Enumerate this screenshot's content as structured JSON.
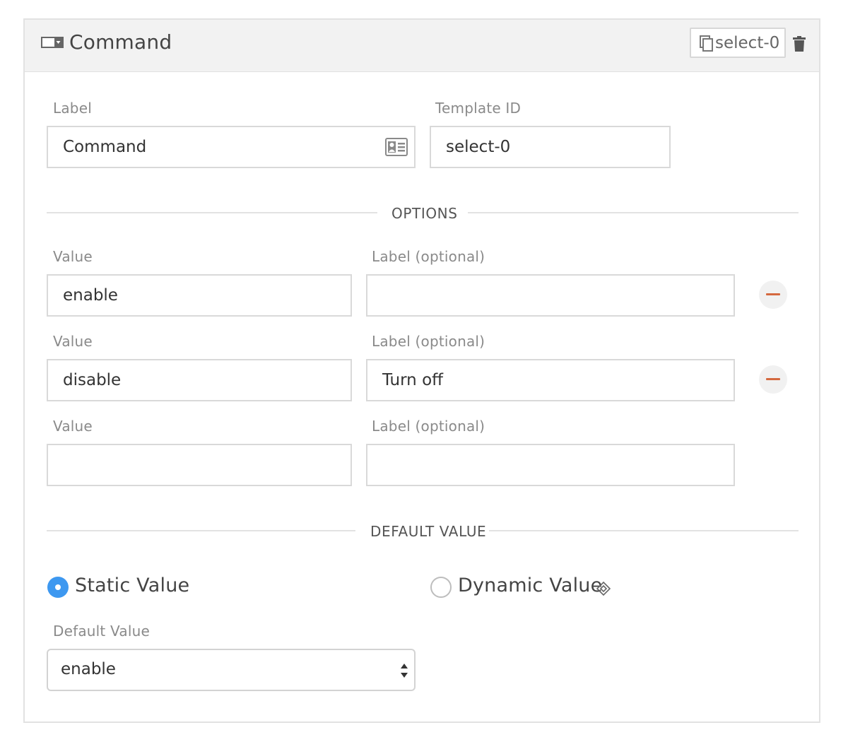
{
  "header": {
    "title": "Command",
    "field_icon": "select-field-icon",
    "id_badge": "select-0",
    "copy_icon": "copy-icon",
    "delete_icon": "trash-icon"
  },
  "fields": {
    "label": {
      "label": "Label",
      "value": "Command",
      "icon": "contact-card-icon"
    },
    "template_id": {
      "label": "Template ID",
      "value": "select-0"
    }
  },
  "options_section": {
    "title": "OPTIONS",
    "rows": [
      {
        "value_label": "Value",
        "value": "enable",
        "label_label": "Label (optional)",
        "label_value": ""
      },
      {
        "value_label": "Value",
        "value": "disable",
        "label_label": "Label (optional)",
        "label_value": "Turn off"
      },
      {
        "value_label": "Value",
        "value": "",
        "label_label": "Label (optional)",
        "label_value": ""
      }
    ],
    "remove_icon": "minus-icon"
  },
  "default_section": {
    "title": "DEFAULT VALUE",
    "static_label": "Static Value",
    "static_selected": true,
    "dynamic_label": "Dynamic Value",
    "dynamic_icon": "diamond-icon",
    "default_value_label": "Default Value",
    "default_value": "enable"
  },
  "colors": {
    "accent": "#3d98f0",
    "remove": "#d4693f",
    "header_bg": "#f2f2f2",
    "border": "#d9d9d9"
  }
}
